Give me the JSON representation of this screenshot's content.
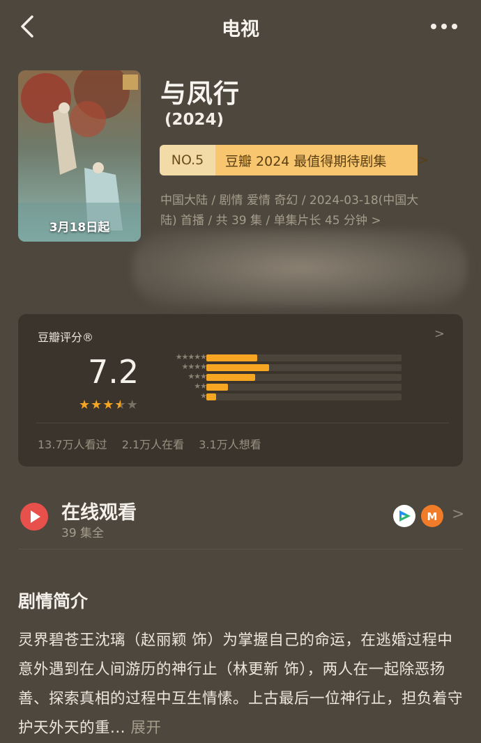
{
  "topbar": {
    "title": "电视",
    "back_icon": "chevron-left-icon",
    "more_icon": "more-horizontal-icon"
  },
  "show": {
    "title": "与凤行",
    "year": "(2024)",
    "poster_caption": "3月18日起",
    "rank": {
      "no": "NO.5",
      "text": "豆瓣 2024 最值得期待剧集",
      "arrow": ">"
    },
    "meta_line1": "中国大陆 / 剧情 爱情 奇幻 / 2024-03-18(中国大",
    "meta_line2": "陆) 首播 / 共 39 集 / 单集片长 45 分钟 >"
  },
  "rating": {
    "label": "豆瓣评分®",
    "chevron": ">",
    "score": "7.2",
    "stars_value": 3.5,
    "stars_max": 5,
    "distribution": [
      {
        "stars": "★★★★★",
        "fraction": 0.26
      },
      {
        "stars": "★★★★",
        "fraction": 0.32
      },
      {
        "stars": "★★★",
        "fraction": 0.25
      },
      {
        "stars": "★★",
        "fraction": 0.11
      },
      {
        "stars": "★",
        "fraction": 0.05
      }
    ],
    "stats": {
      "watched": "13.7万人看过",
      "watching": "2.1万人在看",
      "want": "3.1万人想看"
    }
  },
  "watch": {
    "title": "在线观看",
    "subtitle": "39 集全",
    "platform_icons": [
      "tencent-video-icon",
      "mango-tv-icon"
    ],
    "chevron": ">"
  },
  "synopsis": {
    "title": "剧情简介",
    "text": "灵界碧苍王沈璃（赵丽颖 饰）为掌握自己的命运，在逃婚过程中意外遇到在人间游历的神行止（林更新 饰），两人在一起除恶扬善、探索真相的过程中互生情愫。上古最后一位神行止，担负着守护天外天的重...",
    "expand": "展开"
  },
  "colors": {
    "background": "#4d473e",
    "card": "#3a342c",
    "accent_star": "#f6a623",
    "rank_badge": "#f7c66e",
    "play_red": "#e7504b"
  }
}
